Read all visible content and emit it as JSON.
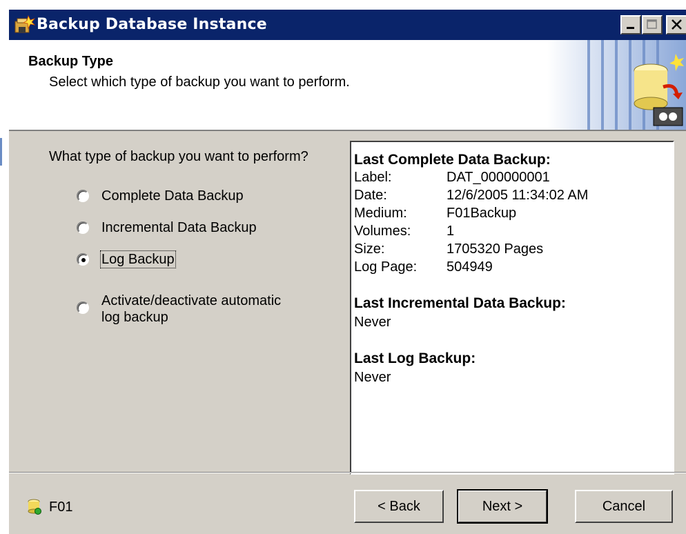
{
  "window": {
    "title": "Backup Database Instance",
    "title_bar_color": "#0a246a",
    "icons": [
      "backup-wizard-icon",
      "minimize-icon",
      "maximize-icon",
      "close-icon"
    ]
  },
  "header": {
    "title": "Backup Type",
    "subtitle": "Select which type of backup you want to perform."
  },
  "question": "What type of backup you want to perform?",
  "options": [
    {
      "label": "Complete Data Backup",
      "selected": false
    },
    {
      "label": "Incremental  Data Backup",
      "selected": false
    },
    {
      "label": "Log Backup",
      "selected": true
    },
    {
      "label_line1": "Activate/deactivate automatic",
      "label_line2": "log backup",
      "selected": false
    }
  ],
  "info": {
    "last_complete": {
      "title": "Last Complete Data Backup:",
      "fields": [
        {
          "key": "Label:",
          "value": "DAT_000000001"
        },
        {
          "key": "Date:",
          "value": "12/6/2005 11:34:02 AM"
        },
        {
          "key": "Medium:",
          "value": "F01Backup"
        },
        {
          "key": "Volumes:",
          "value": "1"
        },
        {
          "key": "Size:",
          "value": "1705320 Pages"
        },
        {
          "key": "Log Page:",
          "value": "504949"
        }
      ]
    },
    "last_incremental": {
      "title": "Last Incremental Data Backup:",
      "value": "Never"
    },
    "last_log": {
      "title": "Last Log Backup:",
      "value": "Never"
    }
  },
  "footer": {
    "instance": "F01",
    "back_label": "< Back",
    "next_label": "Next >",
    "cancel_label": "Cancel"
  }
}
